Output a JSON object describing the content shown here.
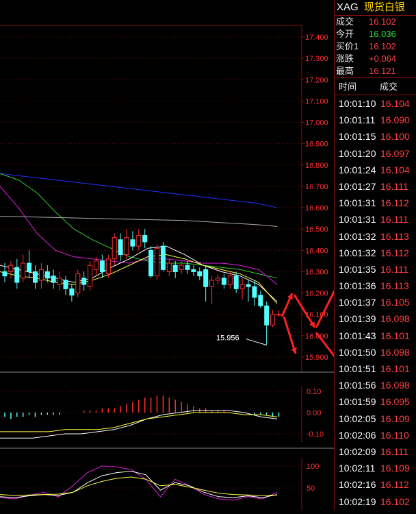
{
  "header": {
    "symbol": "XAG",
    "name": "现货白银"
  },
  "quote": [
    {
      "label": "成交",
      "value": "16.102",
      "color": "red"
    },
    {
      "label": "今开",
      "value": "16.036",
      "color": "green"
    },
    {
      "label": "买价1",
      "value": "16.102",
      "color": "red"
    },
    {
      "label": "涨跌",
      "value": "+0.064",
      "color": "red"
    },
    {
      "label": "最高",
      "value": "16.121",
      "color": "red"
    }
  ],
  "ticks_header": {
    "time": "时间",
    "price": "成交"
  },
  "ticks": [
    {
      "time": "10:01:10",
      "price": "16.104"
    },
    {
      "time": "10:01:11",
      "price": "16.090"
    },
    {
      "time": "10:01:15",
      "price": "16.100"
    },
    {
      "time": "10:01:20",
      "price": "16.097"
    },
    {
      "time": "10:01:24",
      "price": "16.104"
    },
    {
      "time": "10:01:27",
      "price": "16.111"
    },
    {
      "time": "10:01:31",
      "price": "16.112"
    },
    {
      "time": "10:01:31",
      "price": "16.111"
    },
    {
      "time": "10:01:32",
      "price": "16.113"
    },
    {
      "time": "10:01:32",
      "price": "16.112"
    },
    {
      "time": "10:01:35",
      "price": "16.111"
    },
    {
      "time": "10:01:36",
      "price": "16.113"
    },
    {
      "time": "10:01:37",
      "price": "16.105"
    },
    {
      "time": "10:01:39",
      "price": "16.098"
    },
    {
      "time": "10:01:43",
      "price": "16.101"
    },
    {
      "time": "10:01:50",
      "price": "16.098"
    },
    {
      "time": "10:01:51",
      "price": "16.101"
    },
    {
      "time": "10:01:56",
      "price": "16.098"
    },
    {
      "time": "10:01:59",
      "price": "16.095"
    },
    {
      "time": "10:02:05",
      "price": "16.109"
    },
    {
      "time": "10:02:06",
      "price": "16.110"
    },
    {
      "time": "10:02:09",
      "price": "16.111"
    },
    {
      "time": "10:02:11",
      "price": "16.109"
    },
    {
      "time": "10:02:16",
      "price": "16.112"
    },
    {
      "time": "10:02:19",
      "price": "16.102"
    }
  ],
  "main_chart": {
    "price_axis": [
      "17.400",
      "17.300",
      "17.200",
      "17.100",
      "17.000",
      "16.900",
      "16.800",
      "16.700",
      "16.600",
      "16.500",
      "16.400",
      "16.300",
      "16.200",
      "16.100",
      "16.000",
      "15.900"
    ],
    "low_label": "15.956",
    "candles": [
      {
        "o": 16.3,
        "c": 16.28,
        "h": 16.34,
        "l": 16.25
      },
      {
        "o": 16.3,
        "c": 16.33,
        "h": 16.35,
        "l": 16.27
      },
      {
        "o": 16.32,
        "c": 16.25,
        "h": 16.36,
        "l": 16.22
      },
      {
        "o": 16.27,
        "c": 16.34,
        "h": 16.38,
        "l": 16.25
      },
      {
        "o": 16.34,
        "c": 16.3,
        "h": 16.4,
        "l": 16.27
      },
      {
        "o": 16.3,
        "c": 16.25,
        "h": 16.33,
        "l": 16.22
      },
      {
        "o": 16.26,
        "c": 16.31,
        "h": 16.34,
        "l": 16.22
      },
      {
        "o": 16.3,
        "c": 16.27,
        "h": 16.33,
        "l": 16.25
      },
      {
        "o": 16.28,
        "c": 16.25,
        "h": 16.31,
        "l": 16.22
      },
      {
        "o": 16.24,
        "c": 16.27,
        "h": 16.3,
        "l": 16.21
      },
      {
        "o": 16.26,
        "c": 16.22,
        "h": 16.28,
        "l": 16.19
      },
      {
        "o": 16.22,
        "c": 16.19,
        "h": 16.24,
        "l": 16.16
      },
      {
        "o": 16.2,
        "c": 16.29,
        "h": 16.31,
        "l": 16.18
      },
      {
        "o": 16.27,
        "c": 16.24,
        "h": 16.3,
        "l": 16.21
      },
      {
        "o": 16.23,
        "c": 16.33,
        "h": 16.35,
        "l": 16.21
      },
      {
        "o": 16.31,
        "c": 16.35,
        "h": 16.37,
        "l": 16.28
      },
      {
        "o": 16.35,
        "c": 16.3,
        "h": 16.38,
        "l": 16.27
      },
      {
        "o": 16.29,
        "c": 16.36,
        "h": 16.38,
        "l": 16.27
      },
      {
        "o": 16.36,
        "c": 16.46,
        "h": 16.48,
        "l": 16.33
      },
      {
        "o": 16.45,
        "c": 16.38,
        "h": 16.48,
        "l": 16.35
      },
      {
        "o": 16.38,
        "c": 16.46,
        "h": 16.5,
        "l": 16.36
      },
      {
        "o": 16.45,
        "c": 16.42,
        "h": 16.49,
        "l": 16.4
      },
      {
        "o": 16.42,
        "c": 16.47,
        "h": 16.5,
        "l": 16.4
      },
      {
        "o": 16.47,
        "c": 16.44,
        "h": 16.5,
        "l": 16.41
      },
      {
        "o": 16.4,
        "c": 16.28,
        "h": 16.42,
        "l": 16.27
      },
      {
        "o": 16.28,
        "c": 16.41,
        "h": 16.43,
        "l": 16.26
      },
      {
        "o": 16.42,
        "c": 16.31,
        "h": 16.44,
        "l": 16.3
      },
      {
        "o": 16.3,
        "c": 16.34,
        "h": 16.36,
        "l": 16.28
      },
      {
        "o": 16.33,
        "c": 16.3,
        "h": 16.35,
        "l": 16.27
      },
      {
        "o": 16.31,
        "c": 16.33,
        "h": 16.35,
        "l": 16.29
      },
      {
        "o": 16.33,
        "c": 16.31,
        "h": 16.35,
        "l": 16.29
      },
      {
        "o": 16.31,
        "c": 16.3,
        "h": 16.33,
        "l": 16.28
      },
      {
        "o": 16.3,
        "c": 16.28,
        "h": 16.32,
        "l": 16.26
      },
      {
        "o": 16.31,
        "c": 16.23,
        "h": 16.33,
        "l": 16.16
      },
      {
        "o": 16.23,
        "c": 16.26,
        "h": 16.28,
        "l": 16.15
      },
      {
        "o": 16.26,
        "c": 16.27,
        "h": 16.29,
        "l": 16.24
      },
      {
        "o": 16.27,
        "c": 16.24,
        "h": 16.29,
        "l": 16.22
      },
      {
        "o": 16.24,
        "c": 16.28,
        "h": 16.3,
        "l": 16.22
      },
      {
        "o": 16.28,
        "c": 16.22,
        "h": 16.3,
        "l": 16.2
      },
      {
        "o": 16.22,
        "c": 16.24,
        "h": 16.27,
        "l": 16.17
      },
      {
        "o": 16.24,
        "c": 16.23,
        "h": 16.26,
        "l": 16.16
      },
      {
        "o": 16.23,
        "c": 16.18,
        "h": 16.26,
        "l": 16.14
      },
      {
        "o": 16.19,
        "c": 16.14,
        "h": 16.21,
        "l": 16.13
      },
      {
        "o": 16.14,
        "c": 16.05,
        "h": 16.16,
        "l": 15.956
      },
      {
        "o": 16.05,
        "c": 16.1,
        "h": 16.12,
        "l": 16.04
      },
      {
        "o": 16.1,
        "c": 16.1,
        "h": 16.12,
        "l": 16.09
      }
    ],
    "ma_blue": [
      16.76,
      16.75,
      16.74,
      16.73,
      16.72,
      16.71,
      16.7,
      16.69,
      16.68,
      16.67,
      16.66,
      16.65,
      16.64,
      16.63,
      16.62,
      16.6
    ],
    "ma_gray": [
      16.56,
      16.558,
      16.556,
      16.554,
      16.552,
      16.55,
      16.548,
      16.546,
      16.544,
      16.542,
      16.54,
      16.535,
      16.53,
      16.525,
      16.52,
      16.512
    ],
    "ma_green": [
      16.76,
      16.73,
      16.67,
      16.58,
      16.5,
      16.45,
      16.41,
      16.37,
      16.35,
      16.34,
      16.34,
      16.33,
      16.32,
      16.31,
      16.29,
      16.27
    ],
    "ma_magenta": [
      16.7,
      16.6,
      16.48,
      16.4,
      16.37,
      16.36,
      16.35,
      16.34,
      16.36,
      16.36,
      16.35,
      16.34,
      16.34,
      16.33,
      16.31,
      16.24
    ],
    "ma_white": [
      16.33,
      16.31,
      16.29,
      16.27,
      16.25,
      16.27,
      16.32,
      16.36,
      16.41,
      16.42,
      16.38,
      16.33,
      16.3,
      16.28,
      16.24,
      16.16
    ],
    "ma_yellow": [
      16.3,
      16.28,
      16.27,
      16.25,
      16.24,
      16.26,
      16.29,
      16.33,
      16.37,
      16.38,
      16.36,
      16.33,
      16.31,
      16.29,
      16.25,
      16.15
    ]
  },
  "macd": {
    "axis": [
      "0.10",
      "0.00",
      "-0.10"
    ],
    "bars": [
      -0.02,
      -0.03,
      -0.02,
      -0.02,
      -0.01,
      -0.02,
      -0.01,
      -0.01,
      -0.01,
      -0.01,
      0,
      0,
      0,
      0.01,
      0.01,
      0.01,
      0.02,
      0.02,
      0.02,
      0.03,
      0.04,
      0.05,
      0.06,
      0.07,
      0.07,
      0.08,
      0.08,
      0.07,
      0.06,
      0.05,
      0.04,
      0.03,
      0.02,
      0.02,
      0.01,
      0.01,
      0.01,
      0,
      0,
      0,
      0,
      -0.01,
      -0.01,
      -0.01,
      -0.02,
      -0.02
    ],
    "dif": [
      -0.12,
      -0.12,
      -0.12,
      -0.11,
      -0.1,
      -0.1,
      -0.09,
      -0.08,
      -0.06,
      -0.03,
      -0.01,
      0.0,
      0.01,
      0.01,
      0.01,
      0.0,
      -0.02,
      -0.03
    ],
    "dea": [
      -0.09,
      -0.09,
      -0.09,
      -0.09,
      -0.08,
      -0.08,
      -0.08,
      -0.07,
      -0.05,
      -0.03,
      -0.02,
      -0.01,
      0.0,
      0.0,
      0.0,
      -0.01,
      -0.01,
      -0.02
    ]
  },
  "kdj": {
    "axis": [
      "100",
      "50"
    ],
    "k": [
      30,
      28,
      32,
      35,
      33,
      40,
      62,
      78,
      85,
      88,
      80,
      45,
      62,
      55,
      40,
      30,
      28,
      32,
      28,
      35
    ],
    "d": [
      35,
      33,
      34,
      35,
      36,
      40,
      55,
      65,
      72,
      75,
      70,
      55,
      58,
      52,
      45,
      38,
      35,
      34,
      33,
      34
    ],
    "j": [
      28,
      25,
      33,
      40,
      30,
      55,
      85,
      100,
      98,
      92,
      70,
      30,
      70,
      55,
      35,
      25,
      22,
      30,
      25,
      40
    ]
  },
  "colors": {
    "up": "#ff3030",
    "down": "#54ffff",
    "grid": "#8a1010"
  }
}
